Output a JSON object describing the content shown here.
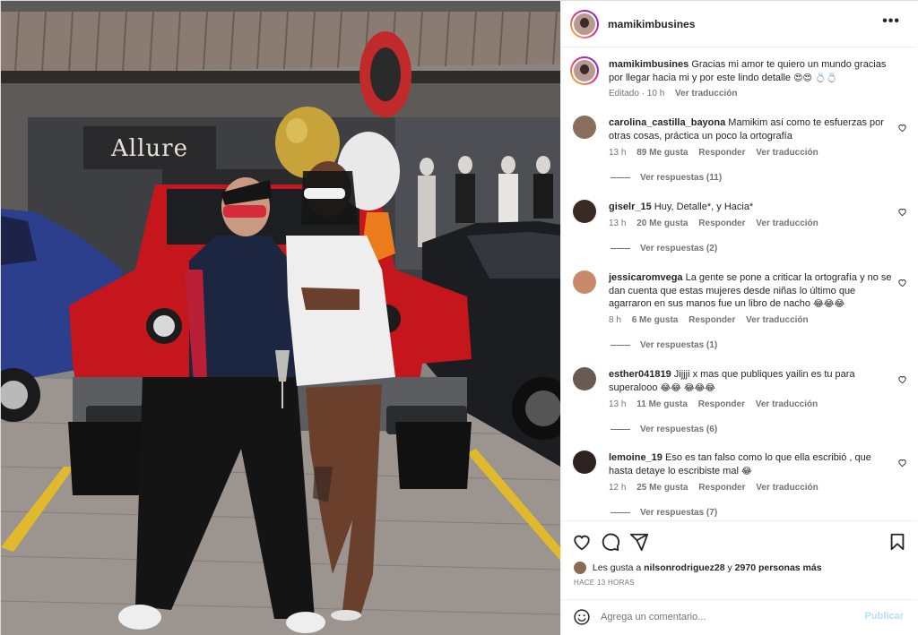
{
  "post": {
    "author": "mamikimbusines",
    "store_sign": "Allure",
    "caption": {
      "username": "mamikimbusines",
      "text": "Gracias mi amor te quiero un mundo gracias por llegar hacia mi y por este lindo detalle",
      "emojis": "😍😍 💍💍",
      "edited_label": "Editado · 10 h",
      "translate_label": "Ver traducción"
    }
  },
  "comments": [
    {
      "username": "carolina_castilla_bayona",
      "text": "Mamikim así como te esfuerzas por otras cosas, práctica un poco la ortografía",
      "emojis": "",
      "time": "13 h",
      "likes": "89 Me gusta",
      "reply": "Responder",
      "translate": "Ver traducción",
      "replies": "Ver respuestas (11)",
      "avatar_color": "#8a6e5c"
    },
    {
      "username": "giselr_15",
      "text": "Huy, Detalle*, y Hacia*",
      "emojis": "",
      "time": "13 h",
      "likes": "20 Me gusta",
      "reply": "Responder",
      "translate": "Ver traducción",
      "replies": "Ver respuestas (2)",
      "avatar_color": "#3a2a24"
    },
    {
      "username": "jessicaromvega",
      "text": "La gente se pone a criticar la ortografía y no se dan cuenta que estas mujeres desde niñas lo último que agarraron en sus manos fue un libro de nacho",
      "emojis": "😂😂😂",
      "time": "8 h",
      "likes": "6 Me gusta",
      "reply": "Responder",
      "translate": "Ver traducción",
      "replies": "Ver respuestas (1)",
      "avatar_color": "#c98a6a"
    },
    {
      "username": "esther041819",
      "text": "Jijjji x mas que publiques yailin es tu para superalooo",
      "emojis": "😂😂",
      "emojis_end": "😂😂😂",
      "time": "13 h",
      "likes": "11 Me gusta",
      "reply": "Responder",
      "translate": "Ver traducción",
      "replies": "Ver respuestas (6)",
      "avatar_color": "#6b5a52"
    },
    {
      "username": "lemoine_19",
      "text": "Eso es tan falso como lo que ella escribió , que hasta detaye lo escribiste mal",
      "emojis": "😂",
      "time": "12 h",
      "likes": "25 Me gusta",
      "reply": "Responder",
      "translate": "Ver traducción",
      "replies": "Ver respuestas (7)",
      "avatar_color": "#2e2320"
    }
  ],
  "actions": {
    "like_icon": "heart-icon",
    "comment_icon": "comment-icon",
    "share_icon": "share-icon",
    "save_icon": "bookmark-icon"
  },
  "likes": {
    "prefix": "Les gusta a",
    "user": "nilsonrodriguez28",
    "connector": "y",
    "others": "2970 personas más"
  },
  "time_ago": "HACE 13 HORAS",
  "add_comment": {
    "placeholder": "Agrega un comentario...",
    "publish_label": "Publicar"
  },
  "colors": {
    "link_blue_disabled": "#b2dffc",
    "secondary_text": "#737373",
    "primary_text": "#262626"
  }
}
